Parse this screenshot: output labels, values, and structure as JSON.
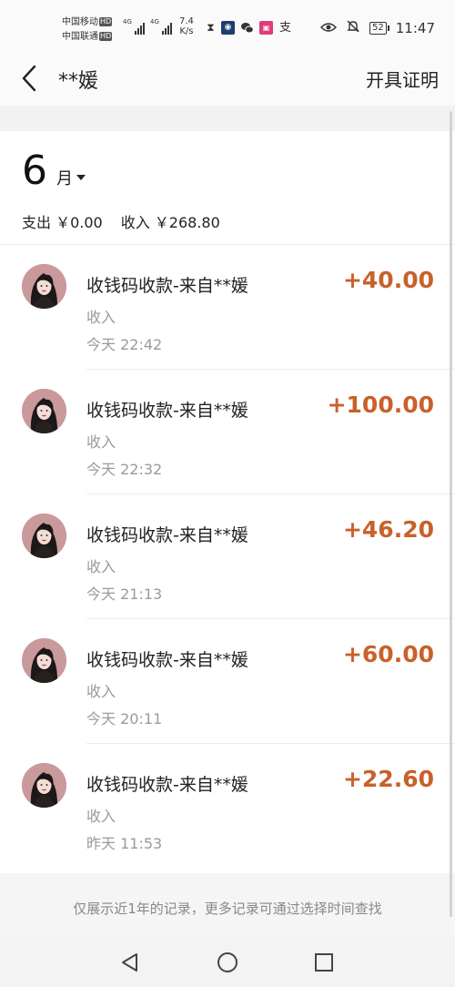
{
  "status_bar": {
    "carrier_1": "中国移动",
    "carrier_2": "中国联通",
    "hd": "HD",
    "net_1": "4G",
    "net_2": "4G",
    "speed_value": "7.4",
    "speed_unit": "K/s",
    "battery": "52",
    "time": "11:47"
  },
  "nav": {
    "title": "**媛",
    "action": "开具证明"
  },
  "month": {
    "number": "6",
    "unit": "月"
  },
  "summary": {
    "expense": "支出 ￥0.00",
    "income": "收入 ￥268.80"
  },
  "transactions": [
    {
      "title": "收钱码收款-来自**媛",
      "type": "收入",
      "time": "今天  22:42",
      "amount": "+40.00"
    },
    {
      "title": "收钱码收款-来自**媛",
      "type": "收入",
      "time": "今天  22:32",
      "amount": "+100.00"
    },
    {
      "title": "收钱码收款-来自**媛",
      "type": "收入",
      "time": "今天  21:13",
      "amount": "+46.20"
    },
    {
      "title": "收钱码收款-来自**媛",
      "type": "收入",
      "time": "今天  20:11",
      "amount": "+60.00"
    },
    {
      "title": "收钱码收款-来自**媛",
      "type": "收入",
      "time": "昨天  11:53",
      "amount": "+22.60"
    }
  ],
  "footer_note": "仅展示近1年的记录，更多记录可通过选择时间查找",
  "colors": {
    "amount": "#c8612a",
    "background": "#f2f2f2",
    "card": "#ffffff"
  }
}
